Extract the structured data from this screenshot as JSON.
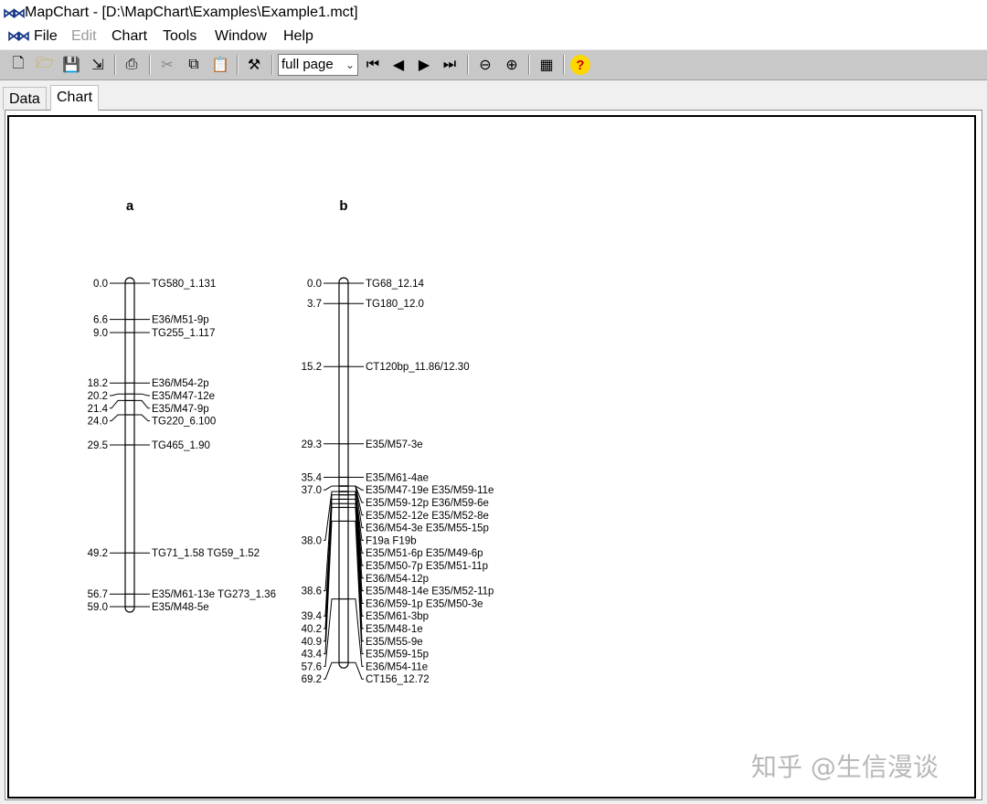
{
  "window": {
    "title": "MapChart - [D:\\MapChart\\Examples\\Example1.mct]"
  },
  "menu": {
    "items": [
      {
        "label": "File",
        "enabled": true
      },
      {
        "label": "Edit",
        "enabled": false
      },
      {
        "label": "Chart",
        "enabled": true
      },
      {
        "label": "Tools",
        "enabled": true
      },
      {
        "label": "Window",
        "enabled": true
      },
      {
        "label": "Help",
        "enabled": true
      }
    ]
  },
  "toolbar": {
    "zoom_value": "full page",
    "icons": [
      "new-icon",
      "open-icon",
      "save-icon",
      "export-icon",
      "print-icon",
      "cut-icon",
      "copy-icon",
      "paste-icon",
      "tools-icon",
      "first-page-icon",
      "previous-page-icon",
      "next-page-icon",
      "last-page-icon",
      "zoom-out-icon",
      "zoom-in-icon",
      "chart-properties-icon",
      "help-icon"
    ]
  },
  "tabs": [
    {
      "label": "Data",
      "active": false
    },
    {
      "label": "Chart",
      "active": true
    }
  ],
  "chart_data": {
    "type": "linkage-map",
    "linkage_groups": [
      {
        "name": "a",
        "markers": [
          {
            "pos": 0.0,
            "pos_label": "0.0",
            "names": [
              "TG580_1.131"
            ]
          },
          {
            "pos": 6.6,
            "pos_label": "6.6",
            "names": [
              "E36/M51-9p"
            ]
          },
          {
            "pos": 9.0,
            "pos_label": "9.0",
            "names": [
              "TG255_1.117"
            ]
          },
          {
            "pos": 18.2,
            "pos_label": "18.2",
            "names": [
              "E36/M54-2p"
            ]
          },
          {
            "pos": 20.2,
            "pos_label": "20.2",
            "names": [
              "E35/M47-12e"
            ]
          },
          {
            "pos": 21.4,
            "pos_label": "21.4",
            "names": [
              "E35/M47-9p"
            ]
          },
          {
            "pos": 24.0,
            "pos_label": "24.0",
            "names": [
              "TG220_6.100"
            ]
          },
          {
            "pos": 29.5,
            "pos_label": "29.5",
            "names": [
              "TG465_1.90"
            ]
          },
          {
            "pos": 49.2,
            "pos_label": "49.2",
            "names": [
              "TG71_1.58 TG59_1.52"
            ]
          },
          {
            "pos": 56.7,
            "pos_label": "56.7",
            "names": [
              "E35/M61-13e TG273_1.36"
            ]
          },
          {
            "pos": 59.0,
            "pos_label": "59.0",
            "names": [
              "E35/M48-5e"
            ]
          }
        ]
      },
      {
        "name": "b",
        "markers": [
          {
            "pos": 0.0,
            "pos_label": "0.0",
            "names": [
              "TG68_12.14"
            ]
          },
          {
            "pos": 3.7,
            "pos_label": "3.7",
            "names": [
              "TG180_12.0"
            ]
          },
          {
            "pos": 15.2,
            "pos_label": "15.2",
            "names": [
              "CT120bp_11.86/12.30"
            ]
          },
          {
            "pos": 29.3,
            "pos_label": "29.3",
            "names": [
              "E35/M57-3e"
            ]
          },
          {
            "pos": 35.4,
            "pos_label": "35.4",
            "names": [
              "E35/M61-4ae"
            ]
          },
          {
            "pos": 37.0,
            "pos_label": "37.0",
            "names": [
              "E35/M47-19e E35/M59-11e",
              "E35/M59-12p E36/M59-6e",
              "E35/M52-12e E35/M52-8e",
              "E36/M54-3e E35/M55-15p"
            ]
          },
          {
            "pos": 38.0,
            "pos_label": "38.0",
            "names": [
              "F19a F19b",
              "E35/M51-6p E35/M49-6p",
              "E35/M50-7p E35/M51-11p",
              "E36/M54-12p"
            ]
          },
          {
            "pos": 38.6,
            "pos_label": "38.6",
            "names": [
              "E35/M48-14e E35/M52-11p",
              "E36/M59-1p E35/M50-3e"
            ]
          },
          {
            "pos": 39.4,
            "pos_label": "39.4",
            "names": [
              "E35/M61-3bp"
            ]
          },
          {
            "pos": 40.2,
            "pos_label": "40.2",
            "names": [
              "E35/M48-1e"
            ]
          },
          {
            "pos": 40.9,
            "pos_label": "40.9",
            "names": [
              "E35/M55-9e"
            ]
          },
          {
            "pos": 43.4,
            "pos_label": "43.4",
            "names": [
              "E35/M59-15p"
            ]
          },
          {
            "pos": 57.6,
            "pos_label": "57.6",
            "names": [
              "E36/M54-11e"
            ]
          },
          {
            "pos": 69.2,
            "pos_label": "69.2",
            "names": [
              "CT156_12.72"
            ]
          }
        ]
      }
    ]
  },
  "watermark": "知乎 @生信漫谈"
}
